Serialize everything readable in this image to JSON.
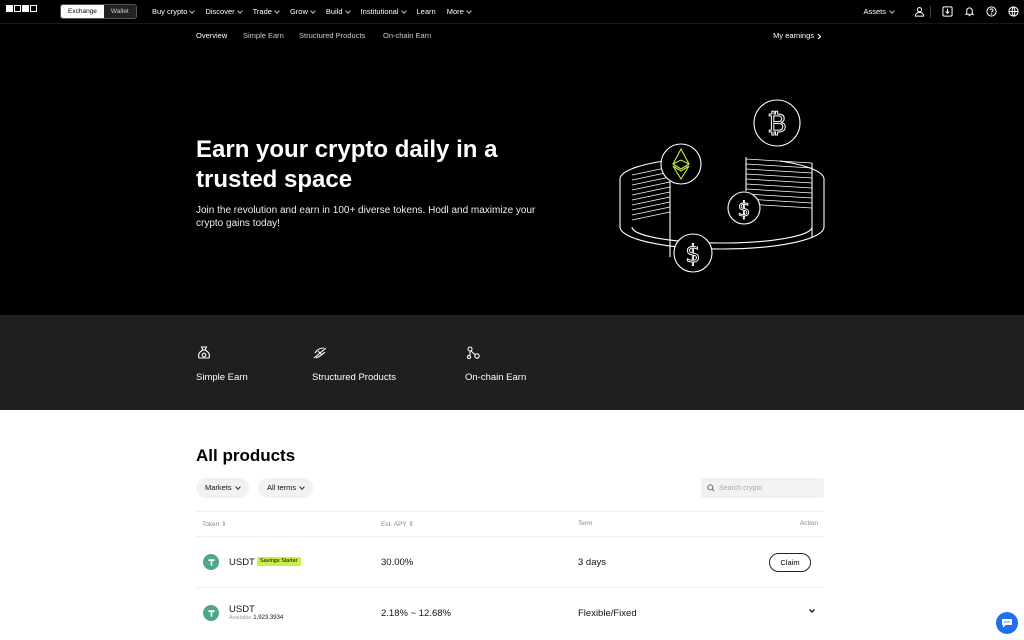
{
  "topnav": {
    "switch": {
      "exchange": "Exchange",
      "wallet": "Wallet"
    },
    "menu": [
      {
        "label": "Buy crypto",
        "chevron": true
      },
      {
        "label": "Discover",
        "chevron": true
      },
      {
        "label": "Trade",
        "chevron": true
      },
      {
        "label": "Grow",
        "chevron": true
      },
      {
        "label": "Build",
        "chevron": true
      },
      {
        "label": "Institutional",
        "chevron": true
      },
      {
        "label": "Learn",
        "chevron": false
      },
      {
        "label": "More",
        "chevron": true
      }
    ],
    "assets": "Assets",
    "icons": [
      "user-icon",
      "download-icon",
      "bell-icon",
      "help-icon",
      "globe-icon"
    ]
  },
  "subnav": {
    "tabs": [
      "Overview",
      "Simple Earn",
      "Structured Products",
      "On-chain Earn"
    ],
    "active": "Overview",
    "my_earnings": "My earnings"
  },
  "hero": {
    "title": "Earn your crypto daily in a trusted space",
    "subtitle": "Join the revolution and earn in 100+ diverse tokens. Hodl and maximize your crypto gains today!"
  },
  "categories": [
    {
      "label": "Simple Earn",
      "icon": "moneybag-icon"
    },
    {
      "label": "Structured Products",
      "icon": "structured-icon"
    },
    {
      "label": "On-chain Earn",
      "icon": "chain-nodes-icon"
    }
  ],
  "products": {
    "title": "All products",
    "filters": [
      "Markets",
      "All terms"
    ],
    "search_placeholder": "Search crypto",
    "columns": {
      "token": "Token",
      "apy": "Est. APY",
      "term": "Term",
      "action": "Action"
    },
    "rows": [
      {
        "token": "USDT",
        "badge": "Savings Starter",
        "apy": "30.00%",
        "term": "3 days",
        "action": "Claim"
      },
      {
        "token": "USDT",
        "available_label": "Available",
        "available": "1,923.3934",
        "apy": "2.18% ~ 12.68%",
        "term": "Flexible/Fixed"
      }
    ]
  },
  "colors": {
    "accent": "#c8f04a",
    "tether": "#50a68a",
    "chat": "#1f6feb"
  }
}
